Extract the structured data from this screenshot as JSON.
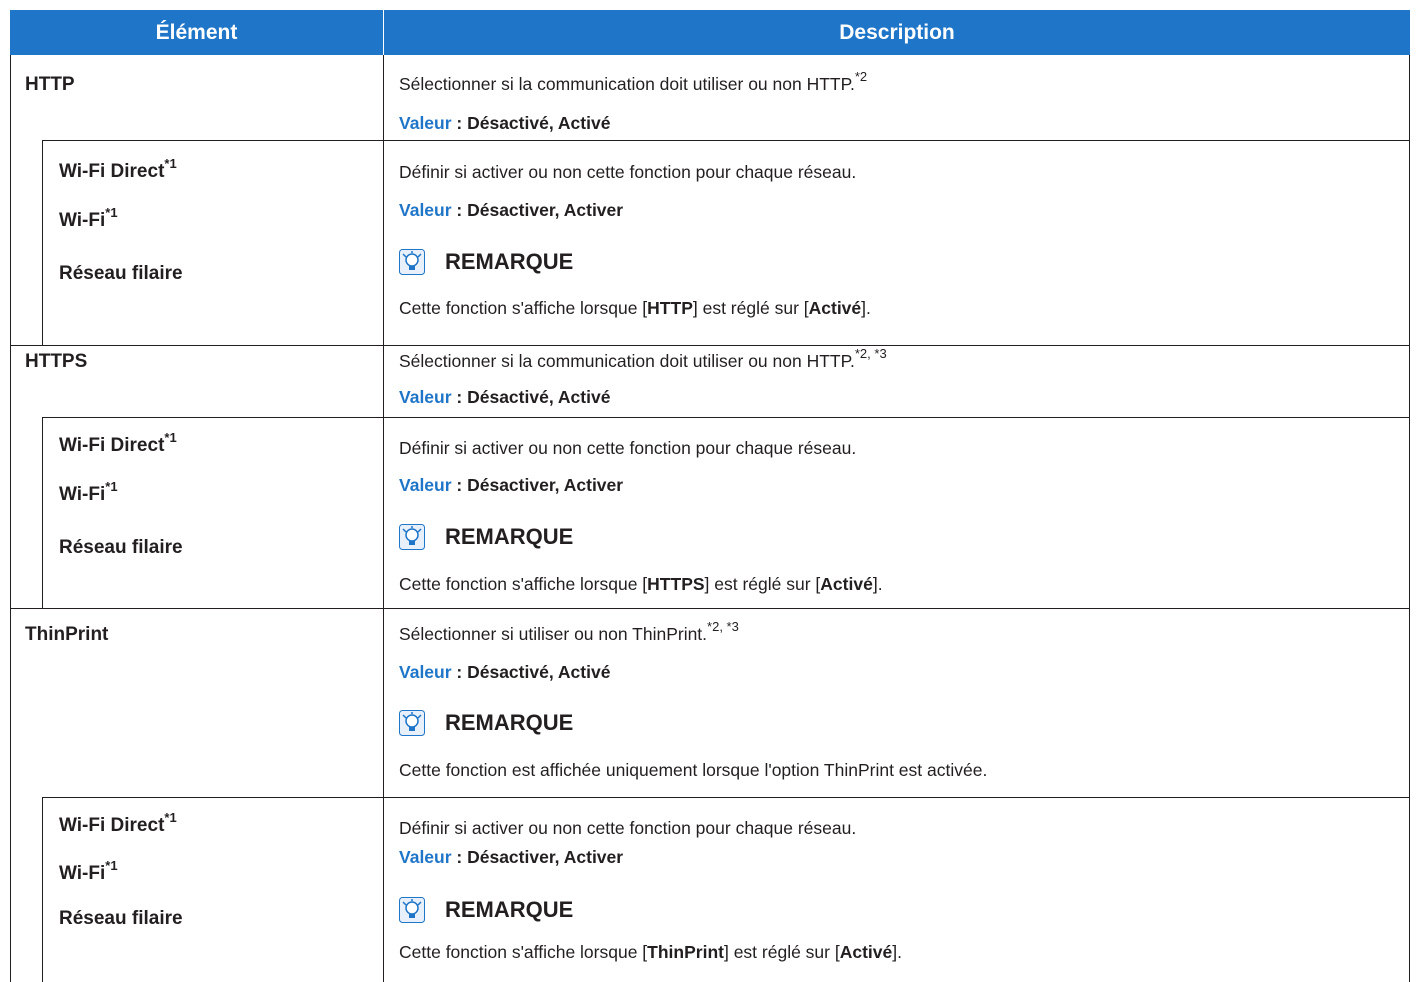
{
  "header": {
    "element": "Élément",
    "description": "Description"
  },
  "http": {
    "label": "HTTP",
    "desc": "Sélectionner si la communication doit utiliser ou non HTTP.",
    "desc_sup": "*2",
    "value_key": "Valeur",
    "value_text": " : Désactivé, Activé",
    "sub": {
      "items": [
        {
          "label": "Wi-Fi Direct",
          "sup": "*1"
        },
        {
          "label": "Wi-Fi",
          "sup": "*1"
        },
        {
          "label": "Réseau filaire",
          "sup": ""
        }
      ],
      "desc": "Définir si activer ou non cette fonction pour chaque réseau.",
      "value_key": "Valeur",
      "value_text": " : Désactiver, Activer",
      "note_title": "REMARQUE",
      "note_pre": "Cette fonction s'affiche lorsque [",
      "note_b1": "HTTP",
      "note_mid": "] est réglé sur [",
      "note_b2": "Activé",
      "note_post": "]."
    }
  },
  "https": {
    "label": "HTTPS",
    "desc": "Sélectionner si la communication doit utiliser ou non HTTP.",
    "desc_sup": "*2, *3",
    "value_key": "Valeur",
    "value_text": " : Désactivé, Activé",
    "sub": {
      "items": [
        {
          "label": "Wi-Fi Direct",
          "sup": "*1"
        },
        {
          "label": "Wi-Fi",
          "sup": "*1"
        },
        {
          "label": "Réseau filaire",
          "sup": ""
        }
      ],
      "desc": "Définir si activer ou non cette fonction pour chaque réseau.",
      "value_key": "Valeur",
      "value_text": " : Désactiver, Activer",
      "note_title": "REMARQUE",
      "note_pre": "Cette fonction s'affiche lorsque [",
      "note_b1": "HTTPS",
      "note_mid": "] est réglé sur [",
      "note_b2": "Activé",
      "note_post": "]."
    }
  },
  "thinprint": {
    "label": "ThinPrint",
    "desc": "Sélectionner si utiliser ou non ThinPrint.",
    "desc_sup": "*2, *3",
    "value_key": "Valeur",
    "value_text": " : Désactivé, Activé",
    "note_title": "REMARQUE",
    "note_text": "Cette fonction est affichée uniquement lorsque l'option ThinPrint est activée.",
    "sub": {
      "items": [
        {
          "label": "Wi-Fi Direct",
          "sup": "*1"
        },
        {
          "label": "Wi-Fi",
          "sup": "*1"
        },
        {
          "label": "Réseau filaire",
          "sup": ""
        }
      ],
      "desc": "Définir si activer ou non cette fonction pour chaque réseau.",
      "value_key": "Valeur",
      "value_text": " : Désactiver, Activer",
      "note_title": "REMARQUE",
      "note_pre": "Cette fonction s'affiche lorsque [",
      "note_b1": "ThinPrint",
      "note_mid": "] est réglé sur [",
      "note_b2": "Activé",
      "note_post": "]."
    }
  }
}
